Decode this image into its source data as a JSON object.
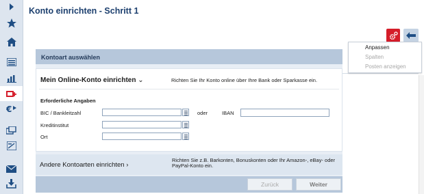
{
  "rail": {
    "icons": [
      {
        "name": "expand-icon",
        "glyph": "▸"
      },
      {
        "name": "star-icon",
        "glyph": "★"
      },
      {
        "name": "home-icon",
        "glyph": "⌂"
      },
      {
        "name": "list-icon",
        "glyph": "▤"
      },
      {
        "name": "chart-icon",
        "glyph": "▁▃▅"
      },
      {
        "name": "add-account-icon",
        "glyph": "+"
      },
      {
        "name": "euro-transfer-icon",
        "glyph": "€"
      },
      {
        "name": "transfer-icon",
        "glyph": "⇄"
      },
      {
        "name": "form-icon",
        "glyph": "▦"
      },
      {
        "name": "mail-icon",
        "glyph": "✉"
      },
      {
        "name": "download-icon",
        "glyph": "⤓"
      }
    ],
    "active": "add-account-icon",
    "accent": "#d51d2a",
    "icon_color": "#1f4e84"
  },
  "header": {
    "title": "Konto einrichten - Schritt 1"
  },
  "menu": {
    "items": [
      {
        "label": "Anpassen",
        "enabled": true
      },
      {
        "label": "Spalten",
        "enabled": false
      },
      {
        "label": "Posten anzeigen",
        "enabled": false
      }
    ]
  },
  "card": {
    "heading": "Kontoart auswählen",
    "online": {
      "title": "Mein Online-Konto einrichten",
      "chevron": "⌄",
      "description": "Richten Sie Ihr Konto online über Ihre Bank oder Sparkasse ein.",
      "required_heading": "Erforderliche Angaben",
      "fields": [
        {
          "label": "BIC / Bankleitzahl",
          "value": ""
        },
        {
          "label": "Kreditinstitut",
          "value": ""
        },
        {
          "label": "Ort",
          "value": ""
        }
      ],
      "or_label": "oder",
      "iban_label": "IBAN",
      "iban_value": ""
    },
    "other": {
      "title": "Andere Kontoarten einrichten ›",
      "description": "Richten Sie z.B. Barkonten, Bonuskonten oder Ihr Amazon-, eBay- oder PayPal-Konto ein."
    },
    "buttons": {
      "back": "Zurück",
      "next": "Weiter"
    }
  }
}
